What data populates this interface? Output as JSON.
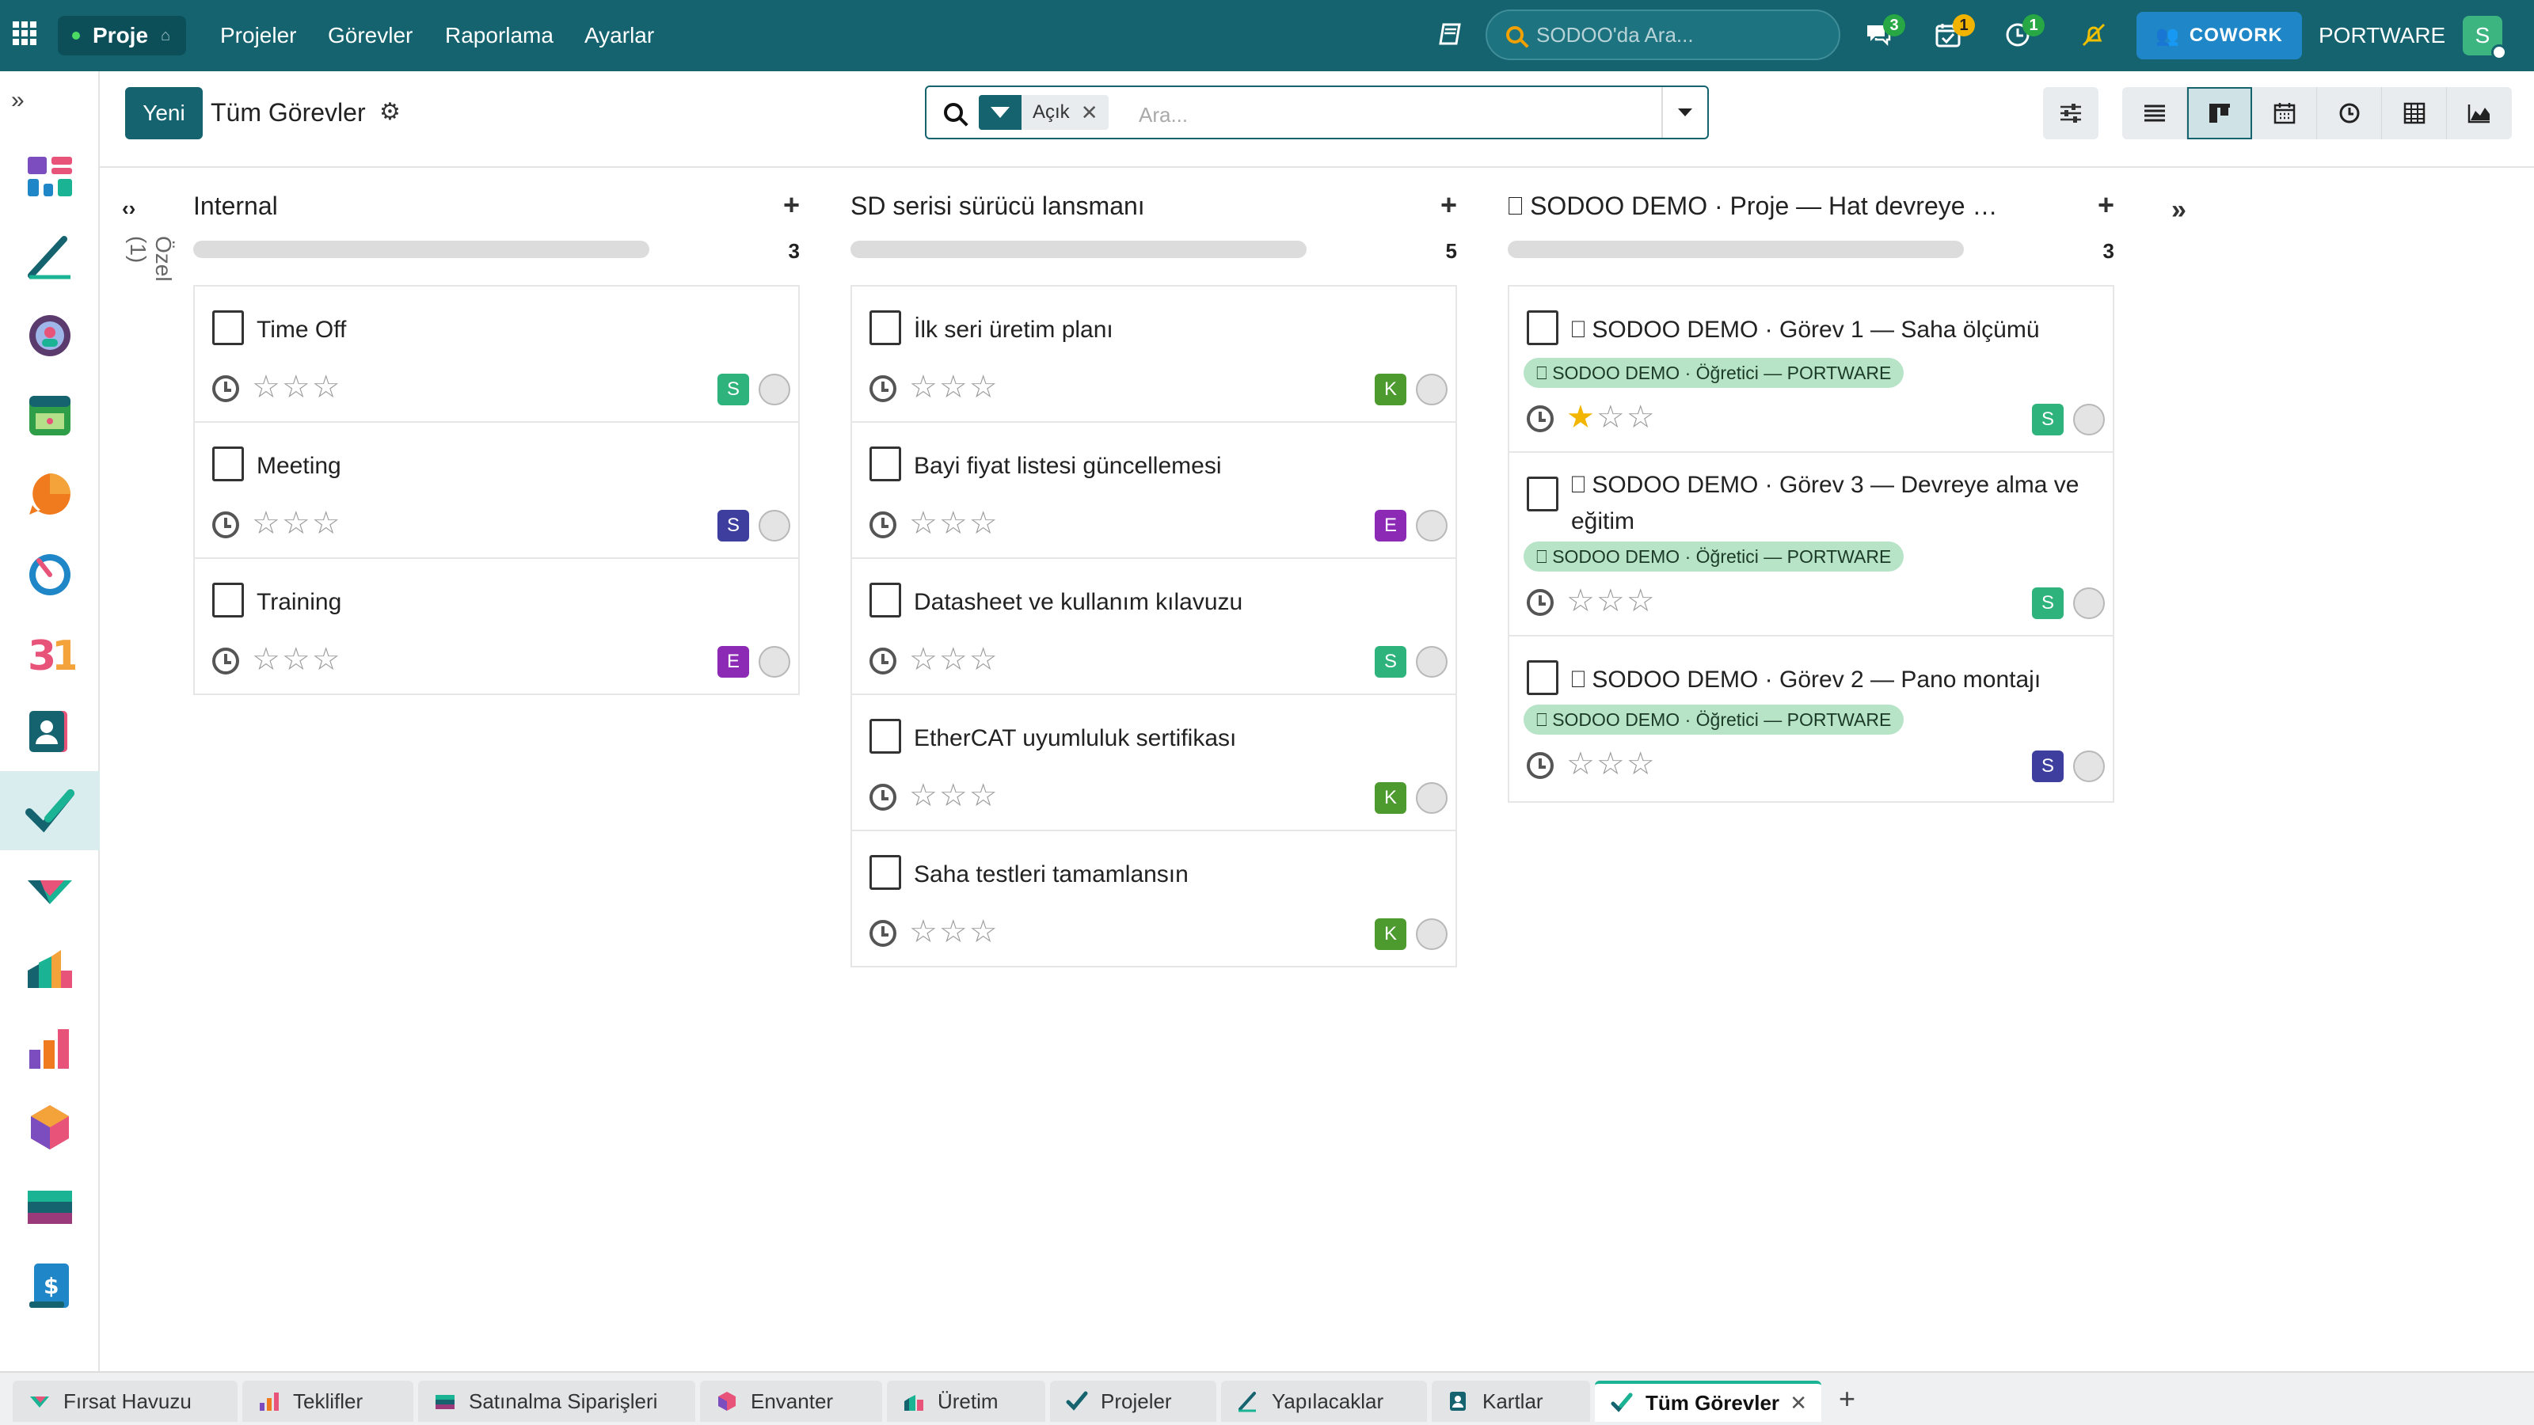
{
  "topbar": {
    "app_name": "Proje",
    "menu": [
      "Projeler",
      "Görevler",
      "Raporlama",
      "Ayarlar"
    ],
    "search_placeholder": "SODOO'da Ara...",
    "badges": {
      "chat": "3",
      "activities": "1",
      "timer": "1"
    },
    "cowork_label": "COWORK",
    "company": "PORTWARE",
    "user_initial": "S"
  },
  "control": {
    "new_label": "Yeni",
    "title": "Tüm Görevler",
    "facet_value": "Açık",
    "search_placeholder": "Ara..."
  },
  "kanban": {
    "folded_label": "Özel (1)",
    "columns": [
      {
        "title": "Internal",
        "count": "3",
        "cards": [
          {
            "title": "Time Off",
            "assignee": "S",
            "assignee_color": "#2fb37c",
            "starred": 0
          },
          {
            "title": "Meeting",
            "assignee": "S",
            "assignee_color": "#3e3e9e",
            "starred": 0
          },
          {
            "title": "Training",
            "assignee": "E",
            "assignee_color": "#8c2ab5",
            "starred": 0
          }
        ]
      },
      {
        "title": "SD serisi sürücü lansmanı",
        "count": "5",
        "cards": [
          {
            "title": "İlk seri üretim planı",
            "assignee": "K",
            "assignee_color": "#4d9a2f",
            "starred": 0
          },
          {
            "title": "Bayi fiyat listesi güncellemesi",
            "assignee": "E",
            "assignee_color": "#8c2ab5",
            "starred": 0
          },
          {
            "title": "Datasheet ve kullanım kılavuzu",
            "assignee": "S",
            "assignee_color": "#2fb37c",
            "starred": 0
          },
          {
            "title": "EtherCAT uyumluluk sertifikası",
            "assignee": "K",
            "assignee_color": "#4d9a2f",
            "starred": 0
          },
          {
            "title": "Saha testleri tamamlansın",
            "assignee": "K",
            "assignee_color": "#4d9a2f",
            "starred": 0
          }
        ]
      },
      {
        "title": "⎕ SODOO DEMO · Proje — Hat devreye …",
        "count": "3",
        "cards": [
          {
            "title": "⎕ SODOO DEMO · Görev 1 — Saha ölçümü",
            "tag": "⎕ SODOO DEMO · Öğretici — PORTWARE",
            "assignee": "S",
            "assignee_color": "#2fb37c",
            "starred": 1
          },
          {
            "title": "⎕ SODOO DEMO · Görev 3 — Devreye alma ve eğitim",
            "tag": "⎕ SODOO DEMO · Öğretici — PORTWARE",
            "assignee": "S",
            "assignee_color": "#2fb37c",
            "starred": 0
          },
          {
            "title": "⎕ SODOO DEMO · Görev 2 — Pano montajı",
            "tag": "⎕ SODOO DEMO · Öğretici — PORTWARE",
            "assignee": "S",
            "assignee_color": "#3e3e9e",
            "starred": 0
          }
        ]
      }
    ]
  },
  "tabs": [
    {
      "label": "Fırsat Havuzu",
      "icon": "crm-icon"
    },
    {
      "label": "Teklifler",
      "icon": "sales-icon"
    },
    {
      "label": "Satınalma Siparişleri",
      "icon": "purchase-icon"
    },
    {
      "label": "Envanter",
      "icon": "inventory-icon"
    },
    {
      "label": "Üretim",
      "icon": "manufacturing-icon"
    },
    {
      "label": "Projeler",
      "icon": "project-icon"
    },
    {
      "label": "Yapılacaklar",
      "icon": "todo-icon"
    },
    {
      "label": "Kartlar",
      "icon": "contacts-icon"
    },
    {
      "label": "Tüm Görevler",
      "icon": "project-icon"
    }
  ],
  "colors": {
    "brand": "#14636f",
    "active_tab": "#1ab394",
    "tag_bg": "#b7e4c7",
    "star": "#f2b600"
  }
}
